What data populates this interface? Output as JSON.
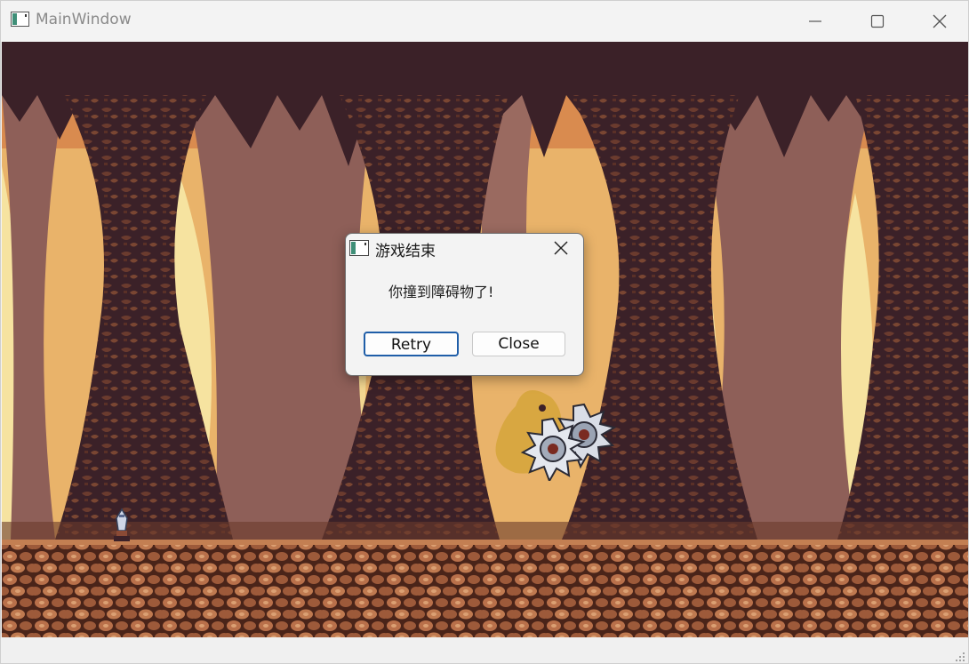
{
  "window": {
    "title": "MainWindow"
  },
  "dialog": {
    "title": "游戏结束",
    "message": "你撞到障碍物了!",
    "retry_label": "Retry",
    "close_label": "Close"
  },
  "colors": {
    "cave_dark": "#3b2128",
    "cave_mid": "#6a3a2c",
    "cave_light": "#f6e3a0",
    "ground": "#b26a45",
    "button_focus_border": "#1f5ea8"
  },
  "icons": {
    "app": "app-window-icon",
    "minimize": "minimize-icon",
    "maximize": "maximize-icon",
    "close": "close-icon"
  }
}
